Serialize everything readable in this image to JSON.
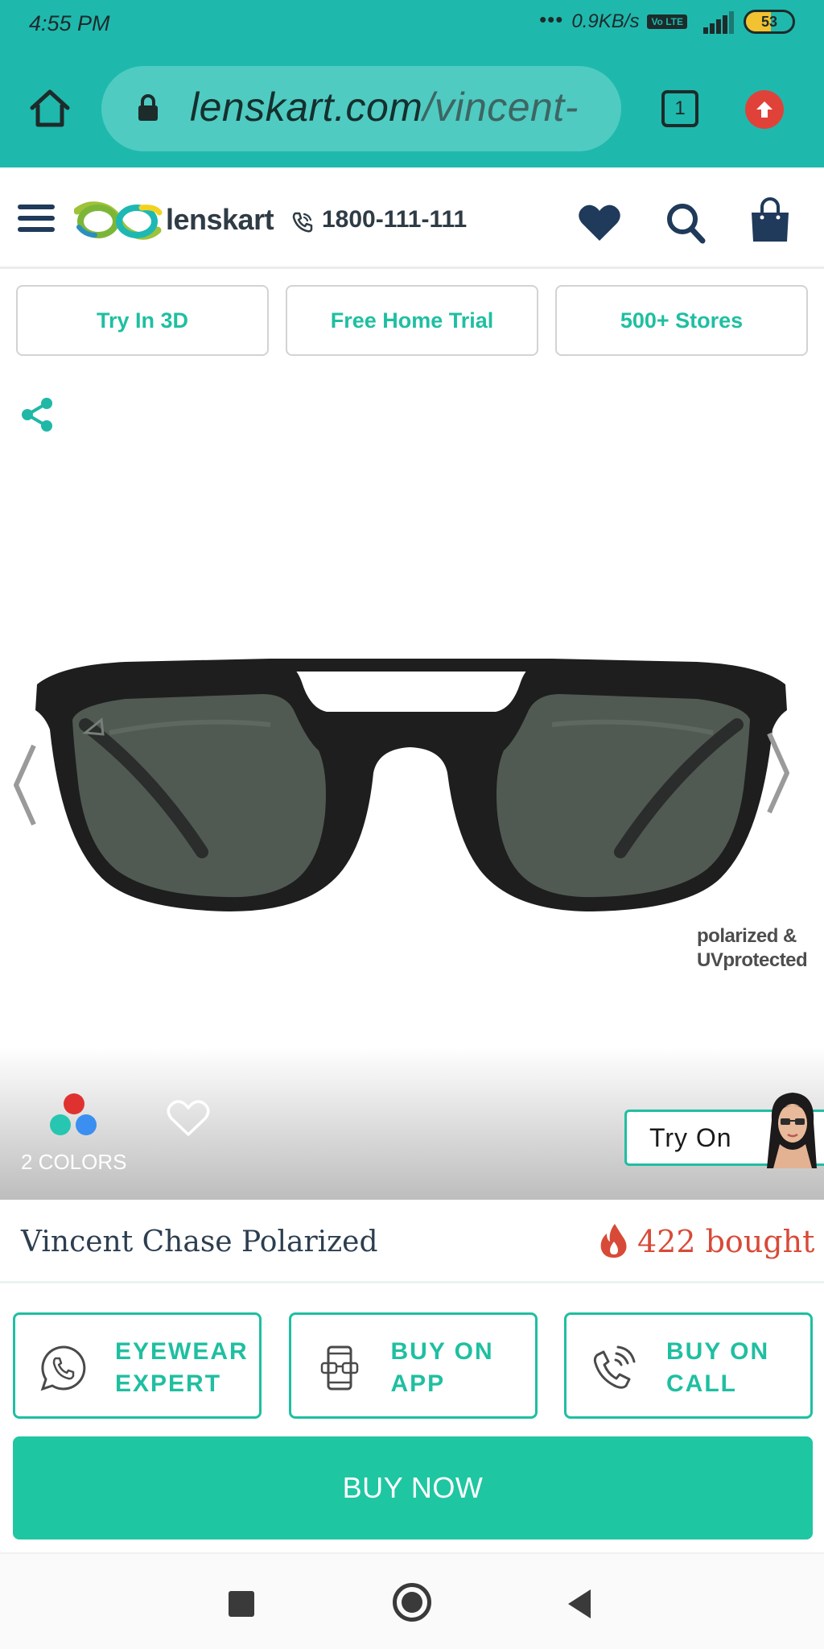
{
  "status_bar": {
    "time": "4:55 PM",
    "network_speed": "0.9KB/s",
    "volte_label": "Vo LTE",
    "network_type": "4G",
    "battery": "53",
    "battery_level": 0.53
  },
  "browser": {
    "url_domain": "lenskart.com",
    "url_path": "/vincent-",
    "tab_count": "1",
    "icons": [
      "home-icon",
      "lock-icon",
      "tabs-icon",
      "update-icon"
    ]
  },
  "header": {
    "brand": "lenskart",
    "phone": "1800-111-111",
    "icons": [
      "hamburger-menu-icon",
      "phone-icon",
      "wishlist-heart-icon",
      "search-icon",
      "cart-bag-icon"
    ]
  },
  "features": [
    {
      "label": "Try In 3D"
    },
    {
      "label": "Free Home Trial"
    },
    {
      "label": "500+ Stores"
    }
  ],
  "product": {
    "badge": "polarized & UVprotected",
    "colors_label": "2 COLORS",
    "color_swatches": [
      "#e03131",
      "#26c6b0",
      "#3b8ff0"
    ],
    "try_on_label": "Try On",
    "name": "Vincent Chase Polarized",
    "bought": "422 bought"
  },
  "actions": [
    {
      "label": "EYEWEAR EXPERT",
      "icon": "whatsapp-icon"
    },
    {
      "label": "BUY ON APP",
      "icon": "phone-glasses-icon"
    },
    {
      "label": "BUY ON CALL",
      "icon": "calling-phone-icon"
    }
  ],
  "buy_now": "BUY NOW",
  "colors": {
    "chrome": "#1fb8ad",
    "accent": "#1fbfa1",
    "buy_button": "#1fc6a2",
    "bought": "#d84a38",
    "navy": "#1f3a5a"
  }
}
